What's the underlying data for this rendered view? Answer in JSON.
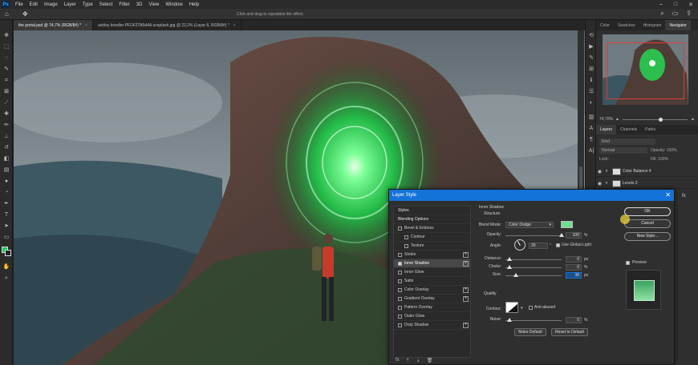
{
  "app": {
    "logo": "Ps",
    "menu": [
      "File",
      "Edit",
      "Image",
      "Layer",
      "Type",
      "Select",
      "Filter",
      "3D",
      "View",
      "Window",
      "Help"
    ]
  },
  "options_bar": {
    "hint": "Click and drag to reposition the effect."
  },
  "documents": {
    "tabs": [
      {
        "label": "the portal.psd @ 74,7% (RGB/8#) *",
        "active": true
      },
      {
        "label": "ashley knedler PFDF2TA5d4A unsplash.jpg @ 22,2% (Layer 6, RGB/8#) *",
        "active": false
      }
    ]
  },
  "right_panels": {
    "top_tabs": [
      "Color",
      "Swatches",
      "Histogram",
      "Navigator"
    ],
    "active_top_tab": "Navigator",
    "zoom_value": "74,70%",
    "zoom_fraction": 0.55,
    "layer_tabs": [
      "Layers",
      "Channels",
      "Paths"
    ],
    "active_layer_tab": "Layers",
    "search_placeholder": "Kind",
    "blend_mode": "Normal",
    "opacity_label": "Opacity: 100%",
    "lock_label": "Lock:",
    "fill_label": "Fill: 100%",
    "layers": [
      {
        "name": "Color Balance 4"
      },
      {
        "name": "Levels 2"
      }
    ]
  },
  "layer_style": {
    "title": "Layer Style",
    "styles_header": "Styles",
    "blending_options": "Blending Options",
    "items": [
      {
        "label": "Bevel & Emboss",
        "checkbox": true,
        "checked": false,
        "plus": false,
        "indent": false
      },
      {
        "label": "Contour",
        "checkbox": true,
        "checked": false,
        "plus": false,
        "indent": true
      },
      {
        "label": "Texture",
        "checkbox": true,
        "checked": false,
        "plus": false,
        "indent": true
      },
      {
        "label": "Stroke",
        "checkbox": true,
        "checked": false,
        "plus": true,
        "indent": false
      },
      {
        "label": "Inner Shadow",
        "checkbox": true,
        "checked": true,
        "plus": true,
        "indent": false,
        "active": true
      },
      {
        "label": "Inner Glow",
        "checkbox": true,
        "checked": false,
        "plus": false,
        "indent": false
      },
      {
        "label": "Satin",
        "checkbox": true,
        "checked": false,
        "plus": false,
        "indent": false
      },
      {
        "label": "Color Overlay",
        "checkbox": true,
        "checked": false,
        "plus": true,
        "indent": false
      },
      {
        "label": "Gradient Overlay",
        "checkbox": true,
        "checked": false,
        "plus": true,
        "indent": false
      },
      {
        "label": "Pattern Overlay",
        "checkbox": true,
        "checked": false,
        "plus": false,
        "indent": false
      },
      {
        "label": "Outer Glow",
        "checkbox": true,
        "checked": false,
        "plus": false,
        "indent": false
      },
      {
        "label": "Drop Shadow",
        "checkbox": true,
        "checked": false,
        "plus": true,
        "indent": false
      }
    ],
    "section_title": "Inner Shadow",
    "structure_title": "Structure",
    "blend_mode_label": "Blend Mode:",
    "blend_mode_value": "Color Dodge",
    "shadow_color": "#6ddf8f",
    "opacity_label": "Opacity:",
    "opacity_value": "100",
    "angle_label": "Angle:",
    "angle_value": "30",
    "global_light_label": "Use Global Light",
    "distance_label": "Distance:",
    "distance_value": "0",
    "choke_label": "Choke:",
    "choke_value": "0",
    "size_label": "Size:",
    "size_value": "38",
    "px_unit": "px",
    "percent_unit": "%",
    "quality_title": "Quality",
    "contour_label": "Contour:",
    "anti_aliased_label": "Anti-aliased",
    "noise_label": "Noise:",
    "noise_value": "0",
    "make_default": "Make Default",
    "reset_default": "Reset to Default",
    "ok": "OK",
    "cancel": "Cancel",
    "new_style": "New Style...",
    "preview_label": "Preview",
    "preview_checked": true,
    "fx_label": "fx"
  }
}
